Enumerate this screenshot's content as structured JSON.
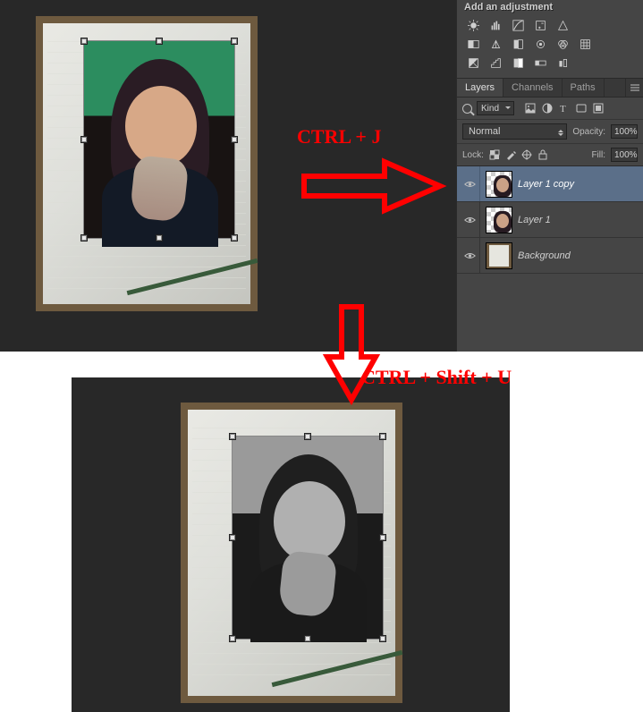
{
  "annotations": {
    "shortcut1": "CTRL + J",
    "shortcut2": "CTRL + Shift + U"
  },
  "adjustments": {
    "header": "Add an adjustment"
  },
  "tabs": {
    "layers": "Layers",
    "channels": "Channels",
    "paths": "Paths"
  },
  "filter": {
    "kind": "Kind"
  },
  "blend": {
    "mode": "Normal",
    "opacityLabel": "Opacity:",
    "opacityValue": "100%",
    "fillLabel": "Fill:",
    "fillValue": "100%"
  },
  "lock": {
    "label": "Lock:"
  },
  "layers": [
    {
      "name": "Layer 1 copy",
      "selected": true,
      "type": "photo"
    },
    {
      "name": "Layer 1",
      "selected": false,
      "type": "photo"
    },
    {
      "name": "Background",
      "selected": false,
      "type": "bg"
    }
  ]
}
